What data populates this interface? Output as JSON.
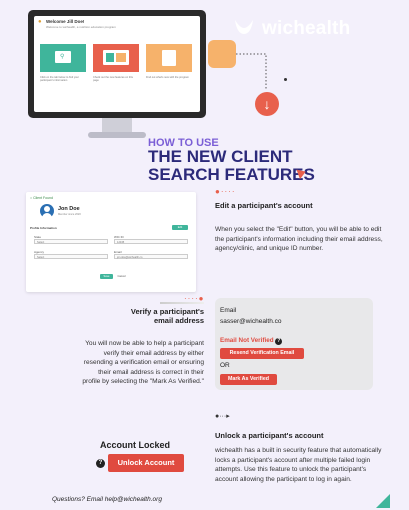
{
  "brand": {
    "name": "wichealth",
    "logo_color": "#ffffff",
    "accent": "#e8604c",
    "purple": "#2c2a7a"
  },
  "monitor": {
    "title": "Welcome Jill Doe!",
    "subtitle": "Welcome to wichealth, a nutrition education program",
    "cards": [
      {
        "color": "#3fb59b",
        "text": "Click on the tab below to find your participant's information"
      },
      {
        "color": "#e8604c",
        "text": "Check out the new features on this page"
      },
      {
        "color": "#f6b26b",
        "text": "Find out what's new with the program"
      }
    ]
  },
  "heading": {
    "small": "HOW TO USE",
    "big_line1": "THE NEW CLIENT",
    "big_line2": "SEARCH FEATURES"
  },
  "client_card": {
    "back_label": "Client Found",
    "name": "Jon Doe",
    "sub": "Member since 2020",
    "section": "Profile Information",
    "edit": "Edit",
    "fields": [
      {
        "label": "State",
        "value": "Select"
      },
      {
        "label": "WIC ID",
        "value": "12345"
      },
      {
        "label": "Agency",
        "value": "Select"
      },
      {
        "label": "Email",
        "value": "jon.doe@wichealth.co"
      }
    ],
    "save": "Save",
    "cancel": "Cancel"
  },
  "edit_section": {
    "title": "Edit a participant's account",
    "body": "When you select the \"Edit\" button, you will be able to edit the participant's information including their email address, agency/clinic, and unique ID number."
  },
  "verify_section": {
    "title_line1": "Verify a participant's",
    "title_line2": "email address",
    "body": "You will now be able to help a participant verify their email address by either resending a verification email or ensuring their email address is correct in their profile by selecting the \"Mark As Verified.\""
  },
  "email_panel": {
    "label": "Email",
    "value": "sasser@wichealth.co",
    "status": "Email Not Verified",
    "resend": "Resend Verification Email",
    "or": "OR",
    "mark": "Mark As Verified"
  },
  "locked": {
    "title": "Account Locked",
    "button": "Unlock Account"
  },
  "unlock_section": {
    "title": "Unlock a participant's account",
    "body": "wichealth has a built in security feature that automatically locks a participant's account after multiple failed login attempts. Use this feature to unlock the participant's account allowing the participant to log in again."
  },
  "footer": {
    "questions": "Questions? Email help@wichealth.org"
  }
}
